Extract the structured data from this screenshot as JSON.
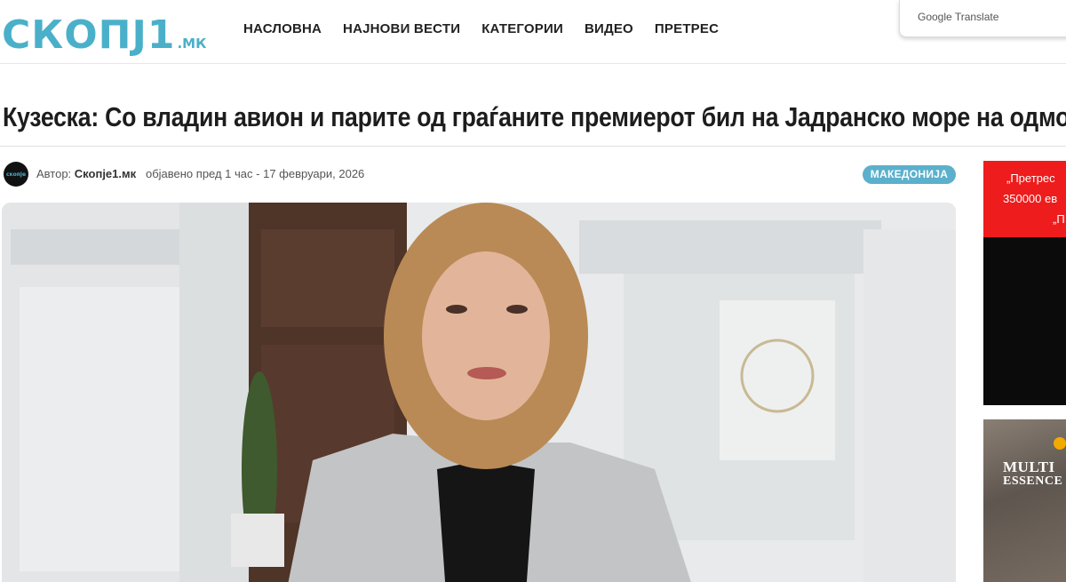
{
  "site": {
    "logo_main": "СКОПЈ1",
    "logo_suffix": ".МК"
  },
  "nav": {
    "items": [
      "НАСЛОВНА",
      "НАЈНОВИ ВЕСТИ",
      "КАТЕГОРИИ",
      "ВИДЕО",
      "ПРЕТРЕС"
    ]
  },
  "translate_widget": {
    "label": "Google Translate"
  },
  "article": {
    "headline": "Кузеска: Со владин авион и парите од граѓаните премиерот бил на Јадранско море на одмор",
    "author_prefix": "Автор:",
    "author": "Скопје1.мк",
    "published": "објавено пред 1 час - 17 февруари, 2026",
    "category": "МАКЕДОНИЈА",
    "avatar_text": "скопје"
  },
  "ads": {
    "ad1_line1": "„Претрес",
    "ad1_line2": "350000 ев",
    "ad1_line3": "„П",
    "ad2_brand_line1": "MULTI",
    "ad2_brand_line2": "ESSENCE"
  },
  "colors": {
    "brand": "#4ab0c9",
    "badge": "#5bb0cc",
    "ad_red": "#ee1c1c"
  }
}
